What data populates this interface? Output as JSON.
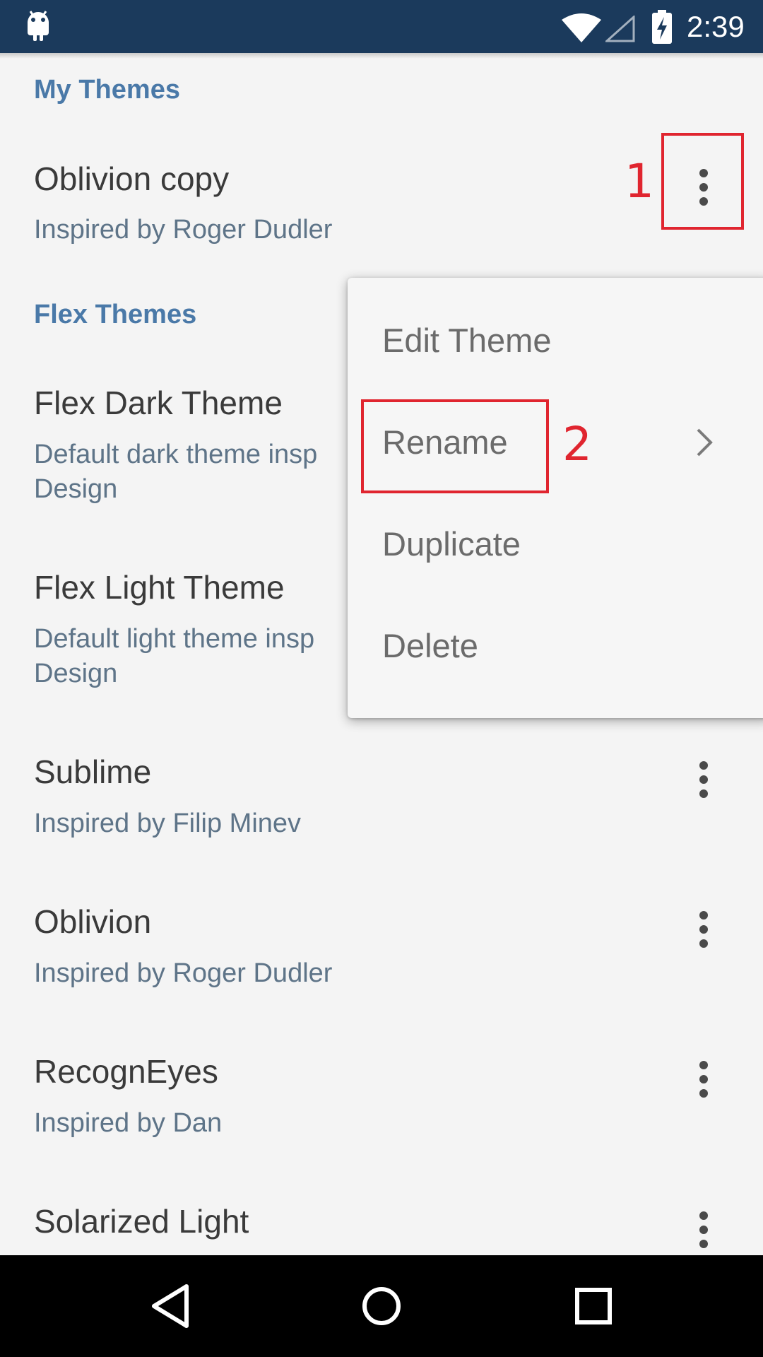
{
  "status_bar": {
    "time": "2:39",
    "icons": [
      "android-debug-icon",
      "wifi-icon",
      "signal-icon",
      "battery-charging-icon"
    ]
  },
  "sections": {
    "my_themes": "My Themes",
    "flex_themes": "Flex Themes"
  },
  "themes": [
    {
      "title": "Oblivion copy",
      "subtitle": "Inspired by Roger Dudler"
    },
    {
      "title": "Flex Dark Theme",
      "subtitle": "Default dark theme insp",
      "subtitle_line2": "Design"
    },
    {
      "title": "Flex Light Theme",
      "subtitle": "Default light theme insp",
      "subtitle_line2": "Design"
    },
    {
      "title": "Sublime",
      "subtitle": "Inspired by Filip Minev"
    },
    {
      "title": "Oblivion",
      "subtitle": "Inspired by Roger Dudler"
    },
    {
      "title": "RecognEyes",
      "subtitle": "Inspired by Dan"
    },
    {
      "title": "Solarized Light",
      "subtitle": ""
    }
  ],
  "popup_menu": {
    "items": [
      "Edit Theme",
      "Rename",
      "Duplicate",
      "Delete"
    ]
  },
  "annotations": {
    "step1": "1",
    "step2": "2",
    "color": "#e0252f"
  },
  "colors": {
    "status_bar": "#1b3a5c",
    "section_header": "#4a79a8",
    "background": "#f4f4f4"
  },
  "nav_bar": {
    "icons": [
      "back-icon",
      "home-icon",
      "recents-icon"
    ]
  }
}
